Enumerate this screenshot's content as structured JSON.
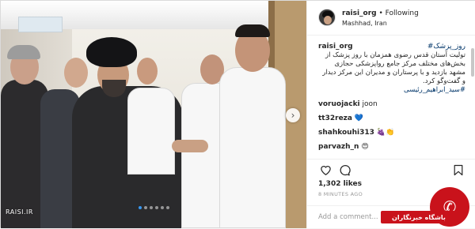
{
  "post": {
    "watermark": "RAISI.IR",
    "carousel_dots": 6,
    "active_dot": 0
  },
  "header": {
    "username": "raisi_org",
    "follow_sep": " • ",
    "follow_label": "Following",
    "location": "Mashhad, Iran"
  },
  "caption": {
    "username": "raisi_org",
    "hashtag_top": "#روز_پزشک",
    "body": "تولیت آستان قدس رضوی همزمان با روز پزشک از بخش‌های مختلف مرکز جامع رواپزشکی حجازی مشهد بازدید و با پرستاران و مدیران این مرکز دیدار و گفت‌وگو کرد.",
    "hashtag_bottom": "#سید_ابراهیم_رئیسی"
  },
  "comments": [
    {
      "user": "voruojacki",
      "text": "joon"
    },
    {
      "user": "tt32reza",
      "text": "💙"
    },
    {
      "user": "shahkouhi313",
      "text": "🍇👏"
    },
    {
      "user": "parvazh_n",
      "text": "😍"
    }
  ],
  "actions": {
    "like_icon": "heart-icon",
    "comment_icon": "comment-icon",
    "save_icon": "bookmark-icon",
    "likes": "1,302 likes",
    "time": "8 MINUTES AGO"
  },
  "add_comment": {
    "placeholder": "Add a comment..."
  },
  "badge": {
    "label": "باشگاه خبرنگاران"
  },
  "colors": {
    "accent": "#3897f0",
    "tag": "#003569",
    "badge": "#c9121b"
  }
}
